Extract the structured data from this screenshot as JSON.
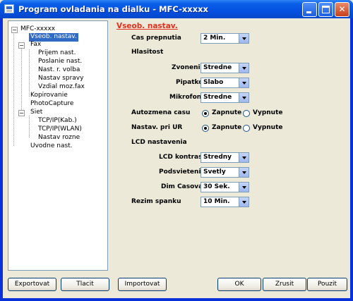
{
  "window": {
    "title": "Program ovladania na dialku - MFC-xxxxx"
  },
  "tree": {
    "root": "MFC-xxxxx",
    "items": [
      "Vseob. nastav.",
      "Fax",
      "Prijem nast.",
      "Poslanie nast.",
      "Nast. r. volba",
      "Nastav spravy",
      "Vzdial moz.fax",
      "Kopirovanie",
      "PhotoCapture",
      "Siet",
      "TCP/IP(Kab.)",
      "TCP/IP(WLAN)",
      "Nastav rozne",
      "Uvodne nast."
    ]
  },
  "panel": {
    "title": "Vseob. nastav.",
    "cas_prepnutia": {
      "label": "Cas prepnutia",
      "value": "2 Min."
    },
    "hlasitost": "Hlasitost",
    "zvonenie": {
      "label": "Zvonenie",
      "value": "Stredne"
    },
    "pipatko": {
      "label": "Pipatko",
      "value": "Slabo"
    },
    "mikrofon": {
      "label": "Mikrofon",
      "value": "Stredne"
    },
    "autozmena": {
      "label": "Autozmena casu",
      "on": "Zapnute",
      "off": "Vypnute"
    },
    "nastav_ur": {
      "label": "Nastav. pri UR",
      "on": "Zapnute",
      "off": "Vypnute"
    },
    "lcd": "LCD nastavenia",
    "lcd_kontrast": {
      "label": "LCD kontrast",
      "value": "Stredny"
    },
    "podsvietenie": {
      "label": "Podsvietenie",
      "value": "Svetly"
    },
    "dim_casovac": {
      "label": "Dim Casovac",
      "value": "30 Sek."
    },
    "rezim_spanku": {
      "label": "Rezim spanku",
      "value": "10 Min."
    }
  },
  "buttons": {
    "export": "Exportovat",
    "print": "Tlacit",
    "import": "Importovat",
    "ok": "OK",
    "cancel": "Zrusit",
    "apply": "Pouzit"
  },
  "colors": {
    "title_bar": "#0a5fe8",
    "selection": "#316ac5",
    "section_title": "#e0301e"
  }
}
